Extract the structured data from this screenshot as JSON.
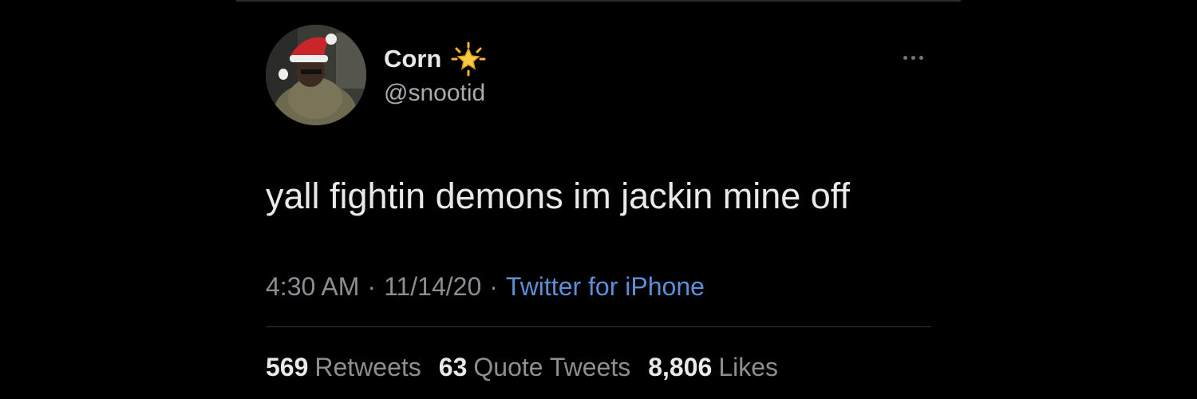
{
  "tweet": {
    "author": {
      "display_name": "Corn",
      "handle": "@snootid",
      "badge_icon": "sparkle-star-emoji-icon"
    },
    "more_icon": "more-horizontal-icon",
    "text": "yall fightin demons im jackin mine off",
    "meta": {
      "time": "4:30 AM",
      "separator": "·",
      "date": "11/14/20",
      "source": "Twitter for iPhone"
    },
    "stats": [
      {
        "count": "569",
        "label": "Retweets"
      },
      {
        "count": "63",
        "label": "Quote Tweets"
      },
      {
        "count": "8,806",
        "label": "Likes"
      }
    ]
  },
  "colors": {
    "background": "#000000",
    "text_primary": "#e7e9ea",
    "text_secondary": "#8b8f94",
    "link": "#5d8fd6",
    "divider": "#2f3336"
  }
}
